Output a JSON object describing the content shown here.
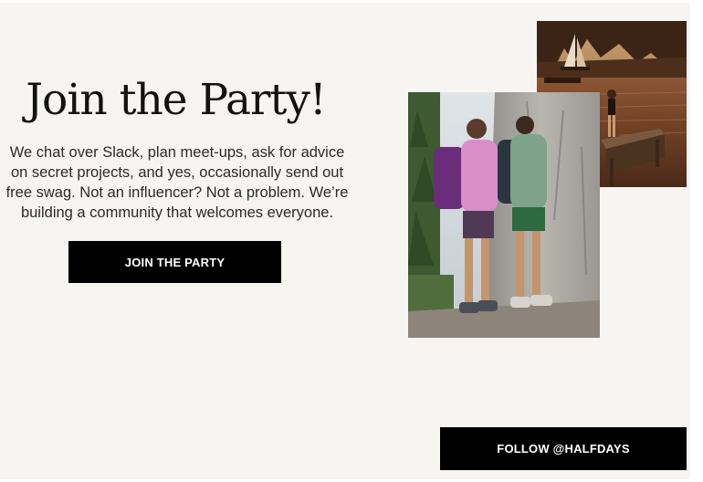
{
  "hero": {
    "headline": "Join the Party!",
    "body_lines": [
      "We chat over Slack, plan meet-ups, ask for advice",
      "on secret projects, and yes, occasionally send out",
      "free swag. Not an influencer? Not a problem. We’re",
      "building a community that welcomes everyone."
    ],
    "cta_label": "JOIN THE PARTY"
  },
  "social": {
    "follow_label": "FOLLOW @HALFDAYS"
  },
  "colors": {
    "background": "#f6f5f1",
    "button": "#000000",
    "button_text": "#ffffff",
    "text": "#121212"
  },
  "images": {
    "lake_photo": "lake-dock-sunset-photo",
    "hikers_photo": "two-hikers-backpacks-photo"
  }
}
